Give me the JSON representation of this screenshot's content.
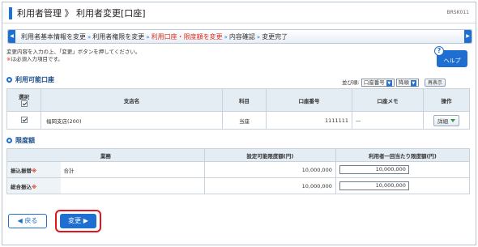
{
  "header": {
    "title": "利用者管理 》 利用者変更[口座]",
    "screen_code": "BRSK011"
  },
  "steps": {
    "items": [
      {
        "label": "利用者基本情報を変更",
        "current": false
      },
      {
        "label": "利用者権限を変更",
        "current": false
      },
      {
        "label": "利用口座・限度額を変更",
        "current": true
      },
      {
        "label": "内容確認",
        "current": false
      },
      {
        "label": "変更完了",
        "current": false
      }
    ],
    "separator": "»"
  },
  "intro": {
    "line1": "変更内容を入力の上、「変更」ボタンを押してください。",
    "req_mark": "※",
    "line2": "は必須入力項目です。"
  },
  "help": {
    "label": "ヘルプ",
    "icon": "?"
  },
  "accounts": {
    "section_title": "利用可能口座",
    "sort": {
      "label": "並び順:",
      "field": "口座番号",
      "order": "降順",
      "redisplay": "再表示"
    },
    "columns": {
      "select": "選択",
      "branch": "支店名",
      "subject": "科目",
      "account_no": "口座番号",
      "memo": "口座メモ",
      "action": "操作"
    },
    "rows": [
      {
        "branch": "福岡支店(200)",
        "subject": "当座",
        "account_no": "1111111",
        "memo": "—",
        "action": "詳細"
      }
    ]
  },
  "limits": {
    "section_title": "限度額",
    "columns": {
      "business": "業務",
      "settable": "設定可能限度額(円)",
      "per_user": "利用者一回当たり限度額(円)"
    },
    "rows": [
      {
        "business": "振込振替",
        "req": "※",
        "sub": "合計",
        "settable": "10,000,000",
        "value": "10,000,000"
      },
      {
        "business": "総合振込",
        "req": "※",
        "sub": "",
        "settable": "10,000,000",
        "value": "10,000,000"
      }
    ]
  },
  "buttons": {
    "back": "戻る",
    "change": "変更"
  },
  "colors": {
    "accent": "#1f6fd1",
    "current_step": "#e0301e",
    "highlight": "#e0141e"
  }
}
